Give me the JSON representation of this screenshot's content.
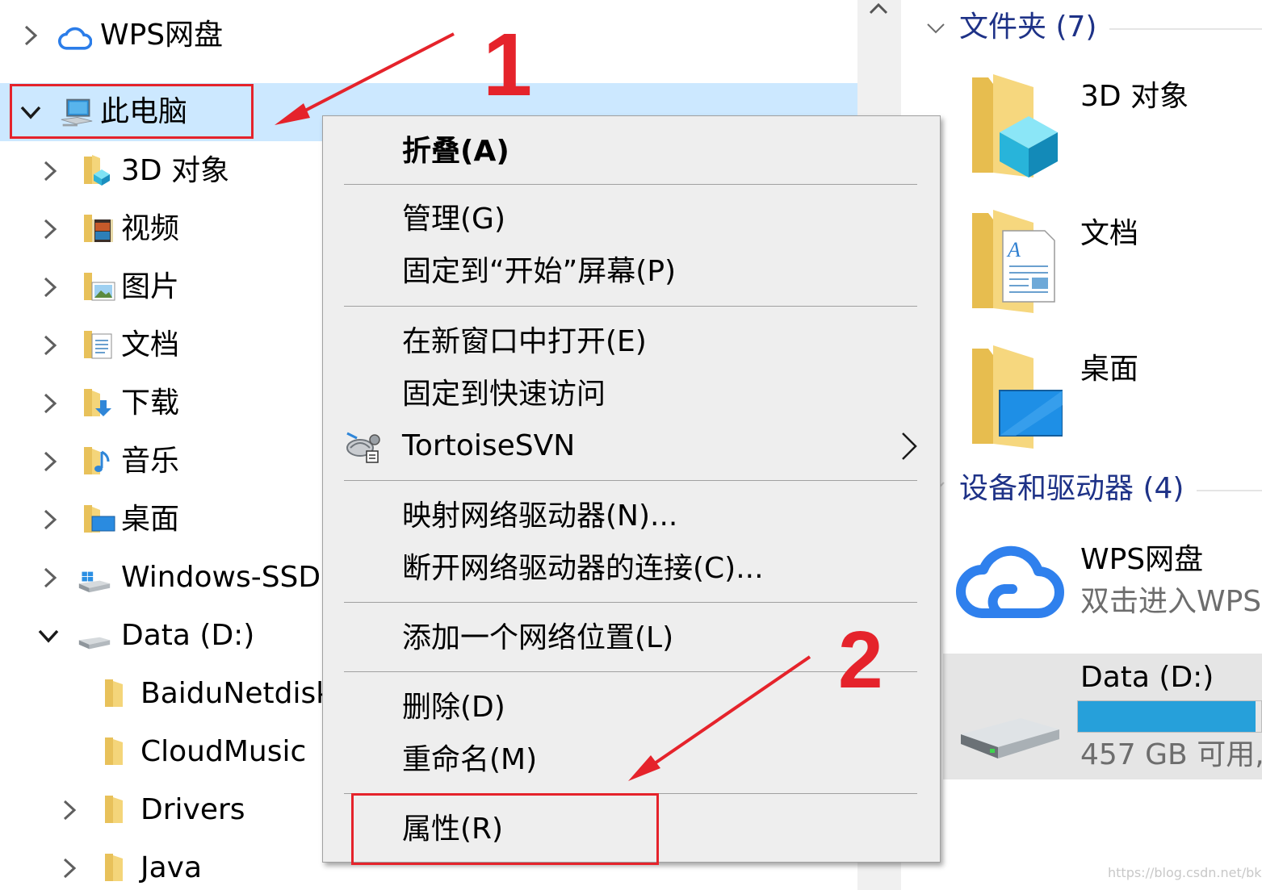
{
  "nav": {
    "items": [
      {
        "label": "WPS网盘",
        "expanded": false,
        "icon": "cloud-icon"
      },
      {
        "label": "此电脑",
        "expanded": true,
        "selected": true,
        "icon": "computer-icon"
      },
      {
        "label": "3D 对象",
        "expanded": false,
        "icon": "3d-objects-folder-icon"
      },
      {
        "label": "视频",
        "expanded": false,
        "icon": "video-folder-icon"
      },
      {
        "label": "图片",
        "expanded": false,
        "icon": "pictures-folder-icon"
      },
      {
        "label": "文档",
        "expanded": false,
        "icon": "documents-folder-icon"
      },
      {
        "label": "下载",
        "expanded": false,
        "icon": "downloads-folder-icon"
      },
      {
        "label": "音乐",
        "expanded": false,
        "icon": "music-folder-icon"
      },
      {
        "label": "桌面",
        "expanded": false,
        "icon": "desktop-folder-icon"
      },
      {
        "label": "Windows-SSD",
        "expanded": false,
        "icon": "system-drive-icon"
      },
      {
        "label": "Data (D:)",
        "expanded": true,
        "icon": "drive-icon"
      },
      {
        "label": "BaiduNetdisk",
        "icon": "folder-icon"
      },
      {
        "label": "CloudMusic",
        "icon": "folder-icon"
      },
      {
        "label": "Drivers",
        "expanded": false,
        "icon": "folder-icon"
      },
      {
        "label": "Java",
        "expanded": false,
        "icon": "folder-icon"
      }
    ]
  },
  "context_menu": {
    "items": [
      {
        "label": "折叠(A)",
        "bold": true
      },
      {
        "label": "管理(G)"
      },
      {
        "label": "固定到“开始”屏幕(P)"
      },
      {
        "label": "在新窗口中打开(E)"
      },
      {
        "label": "固定到快速访问"
      },
      {
        "label": "TortoiseSVN",
        "submenu": true,
        "icon": "tortoisesvn-icon"
      },
      {
        "label": "映射网络驱动器(N)..."
      },
      {
        "label": "断开网络驱动器的连接(C)..."
      },
      {
        "label": "添加一个网络位置(L)"
      },
      {
        "label": "删除(D)"
      },
      {
        "label": "重命名(M)"
      },
      {
        "label": "属性(R)"
      }
    ]
  },
  "content": {
    "folders_header": "文件夹 (7)",
    "folders": [
      {
        "name": "3D 对象",
        "icon": "3d-objects-large-icon"
      },
      {
        "name": "文档",
        "icon": "documents-large-icon"
      },
      {
        "name": "桌面",
        "icon": "desktop-large-icon"
      }
    ],
    "devices_header": "设备和驱动器 (4)",
    "devices": [
      {
        "name": "WPS网盘",
        "sub": "双击进入WPS",
        "icon": "wps-cloud-large-icon"
      },
      {
        "name": "Data (D:)",
        "sub": "457 GB 可用,",
        "icon": "drive-large-icon",
        "used_fraction": 0.97
      }
    ]
  },
  "annotations": {
    "step1": "1",
    "step2": "2",
    "color": "#e5232b"
  },
  "watermark": "https://blog.csdn.net/bkqkl",
  "colors": {
    "selection": "#cce8ff",
    "group_header": "#1e3287",
    "drive_bar": "#26a0da",
    "menu_bg": "#eeeeee"
  }
}
